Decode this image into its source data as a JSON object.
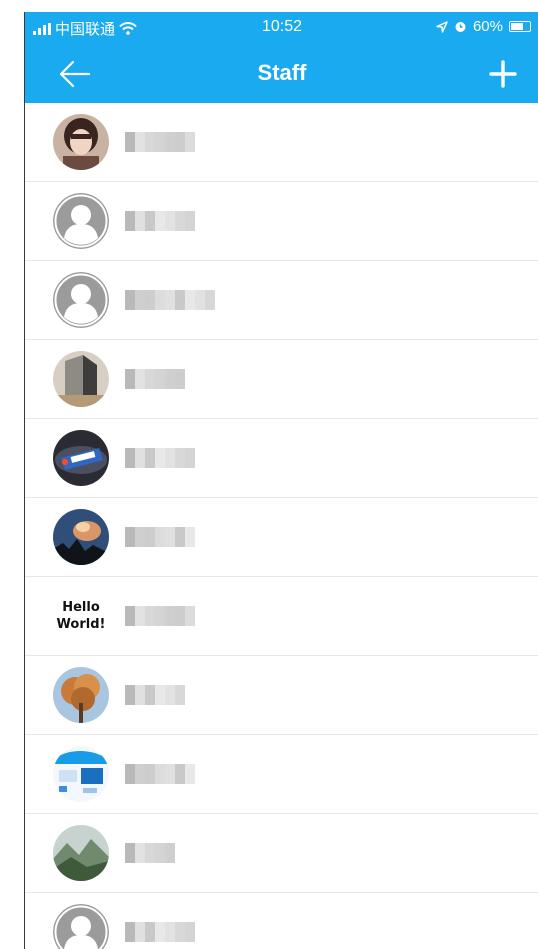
{
  "status_bar": {
    "carrier": "中国联通",
    "time": "10:52",
    "battery": "60%",
    "battery_level": 0.6
  },
  "nav": {
    "title": "Staff",
    "back_icon": "arrow-left-icon",
    "add_icon": "plus-icon"
  },
  "colors": {
    "accent": "#1aaaf0",
    "divider": "#e6e6e6"
  },
  "staff": [
    {
      "avatar_type": "photo-woman",
      "name": ""
    },
    {
      "avatar_type": "default",
      "name": ""
    },
    {
      "avatar_type": "default",
      "name": "Kevin Wu"
    },
    {
      "avatar_type": "photo-book",
      "name": ""
    },
    {
      "avatar_type": "photo-logo",
      "name": ""
    },
    {
      "avatar_type": "photo-sky",
      "name": ""
    },
    {
      "avatar_type": "text",
      "name": "",
      "avatar_lines": [
        "Hello",
        "World!"
      ]
    },
    {
      "avatar_type": "photo-tree",
      "name": ""
    },
    {
      "avatar_type": "photo-screen",
      "name": ""
    },
    {
      "avatar_type": "photo-mountain",
      "name": ""
    },
    {
      "avatar_type": "default",
      "name": ""
    }
  ]
}
